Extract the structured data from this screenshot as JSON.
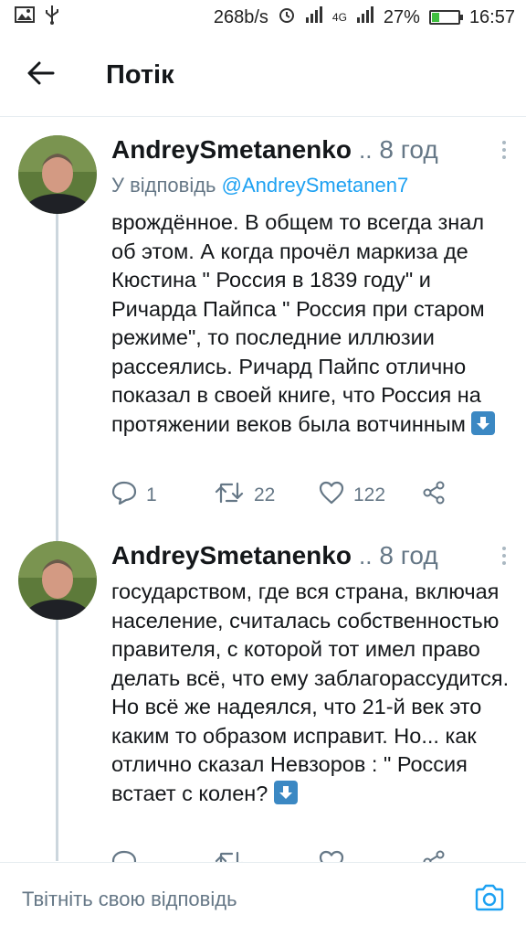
{
  "status_bar": {
    "speed": "268b/s",
    "network": "4G",
    "battery_percent": "27%",
    "battery_level": 0.27,
    "time": "16:57"
  },
  "header": {
    "title": "Потік"
  },
  "tweets": [
    {
      "author": "AndreySmetanenko",
      "ellipsis": "..",
      "time": "8 год",
      "reply_prefix": "У відповідь",
      "reply_handle": "@AndreySmetanen7",
      "text": "врождённое. В общем то всегда знал об этом. А когда прочёл маркиза де Кюстина \" Россия в 1839 году\" и Ричарда Пайпса \" Россия при старом режиме\", то последние иллюзии рассеялись. Ричард Пайпс отлично показал в своей книге, что Россия на протяжении веков была вотчинным",
      "replies": "1",
      "retweets": "22",
      "likes": "122"
    },
    {
      "author": "AndreySmetanenko",
      "ellipsis": "..",
      "time": "8 год",
      "text": "государством, где вся страна, включая население, считалась собственностью правителя, с которой тот имел право делать всё, что ему заблагорассудится. Но всё же надеялся, что 21-й век это каким то образом исправит. Но... как отлично сказал Невзоров : \" Россия встает с колен?",
      "replies": "",
      "retweets": "",
      "likes": ""
    }
  ],
  "compose": {
    "placeholder": "Твітніть свою відповідь"
  },
  "colors": {
    "accent": "#1da1f2",
    "secondary_text": "#657786",
    "divider": "#e6ecf0"
  }
}
